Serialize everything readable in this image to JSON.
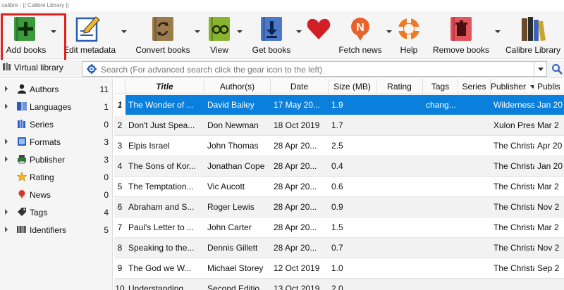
{
  "window": {
    "title": "calibre - || Calibre Library ||"
  },
  "toolbar": {
    "buttons": [
      {
        "label": "Add books",
        "icon": "add-books-icon"
      },
      {
        "label": "Edit metadata",
        "icon": "edit-metadata-icon"
      },
      {
        "label": "Convert books",
        "icon": "convert-books-icon"
      },
      {
        "label": "View",
        "icon": "view-icon"
      },
      {
        "label": "Get books",
        "icon": "get-books-icon"
      },
      {
        "label": "Fetch news",
        "icon": "fetch-news-icon"
      },
      {
        "label": "Help",
        "icon": "help-icon"
      },
      {
        "label": "Remove books",
        "icon": "remove-books-icon"
      },
      {
        "label": "Calibre Library",
        "icon": "calibre-library-icon"
      }
    ],
    "highlight_color": "#e0221f"
  },
  "search": {
    "virtual_library": "Virtual library",
    "placeholder": "Search (For advanced search click the gear icon to the left)"
  },
  "sidebar": {
    "items": [
      {
        "label": "Authors",
        "count": "11",
        "icon": "person-icon",
        "expandable": true
      },
      {
        "label": "Languages",
        "count": "1",
        "icon": "languages-icon",
        "expandable": true
      },
      {
        "label": "Series",
        "count": "0",
        "icon": "series-icon",
        "expandable": false
      },
      {
        "label": "Formats",
        "count": "3",
        "icon": "formats-icon",
        "expandable": true
      },
      {
        "label": "Publisher",
        "count": "3",
        "icon": "publisher-icon",
        "expandable": true
      },
      {
        "label": "Rating",
        "count": "0",
        "icon": "star-icon",
        "expandable": false
      },
      {
        "label": "News",
        "count": "0",
        "icon": "news-icon",
        "expandable": false
      },
      {
        "label": "Tags",
        "count": "4",
        "icon": "tag-icon",
        "expandable": true
      },
      {
        "label": "Identifiers",
        "count": "5",
        "icon": "barcode-icon",
        "expandable": true
      }
    ]
  },
  "table": {
    "columns": [
      "",
      "Title",
      "Author(s)",
      "Date",
      "Size (MB)",
      "Rating",
      "Tags",
      "Series",
      "Publisher",
      "Publis"
    ],
    "selected_color": "#0a7fdb",
    "rows": [
      {
        "num": "1",
        "title": "The Wonder of ...",
        "author": "David Bailey",
        "date": "17 May 20...",
        "size": "1.9",
        "rating": "",
        "tags": "chang...",
        "series": "",
        "publisher": "Wilderness ...",
        "pubdate": "Jan 20"
      },
      {
        "num": "2",
        "title": "Don't Just Spea...",
        "author": "Don Newman",
        "date": "18 Oct 2019",
        "size": "1.7",
        "rating": "",
        "tags": "",
        "series": "",
        "publisher": "Xulon Press",
        "pubdate": "Mar 2"
      },
      {
        "num": "3",
        "title": "Elpis Israel",
        "author": "John Thomas",
        "date": "28 Apr 20...",
        "size": "2.5",
        "rating": "",
        "tags": "",
        "series": "",
        "publisher": "The Christa...",
        "pubdate": "Apr 20"
      },
      {
        "num": "4",
        "title": "The Sons of Kor...",
        "author": "Jonathan Cope",
        "date": "28 Apr 20...",
        "size": "0.4",
        "rating": "",
        "tags": "",
        "series": "",
        "publisher": "The Christa...",
        "pubdate": "Jan 20"
      },
      {
        "num": "5",
        "title": "The Temptation...",
        "author": "Vic Aucott",
        "date": "28 Apr 20...",
        "size": "0.6",
        "rating": "",
        "tags": "",
        "series": "",
        "publisher": "The Christa...",
        "pubdate": "Mar 2"
      },
      {
        "num": "6",
        "title": "Abraham and S...",
        "author": "Roger Lewis",
        "date": "28 Apr 20...",
        "size": "0.9",
        "rating": "",
        "tags": "",
        "series": "",
        "publisher": "The Christa...",
        "pubdate": "Nov 2"
      },
      {
        "num": "7",
        "title": "Paul's Letter to ...",
        "author": "John Carter",
        "date": "28 Apr 20...",
        "size": "1.5",
        "rating": "",
        "tags": "",
        "series": "",
        "publisher": "The Christa...",
        "pubdate": "Mar 2"
      },
      {
        "num": "8",
        "title": "Speaking to the...",
        "author": "Dennis Gillett",
        "date": "28 Apr 20...",
        "size": "0.7",
        "rating": "",
        "tags": "",
        "series": "",
        "publisher": "The Christa...",
        "pubdate": "Nov 2"
      },
      {
        "num": "9",
        "title": "The God we W...",
        "author": "Michael Storey",
        "date": "12 Oct 2019",
        "size": "1.0",
        "rating": "",
        "tags": "",
        "series": "",
        "publisher": "The Christa...",
        "pubdate": "Sep 2"
      },
      {
        "num": "10",
        "title": "Understanding ...",
        "author": "Second Editio...",
        "date": "13 Oct 2019",
        "size": "2.0",
        "rating": "",
        "tags": "",
        "series": "",
        "publisher": "",
        "pubdate": ""
      }
    ]
  }
}
